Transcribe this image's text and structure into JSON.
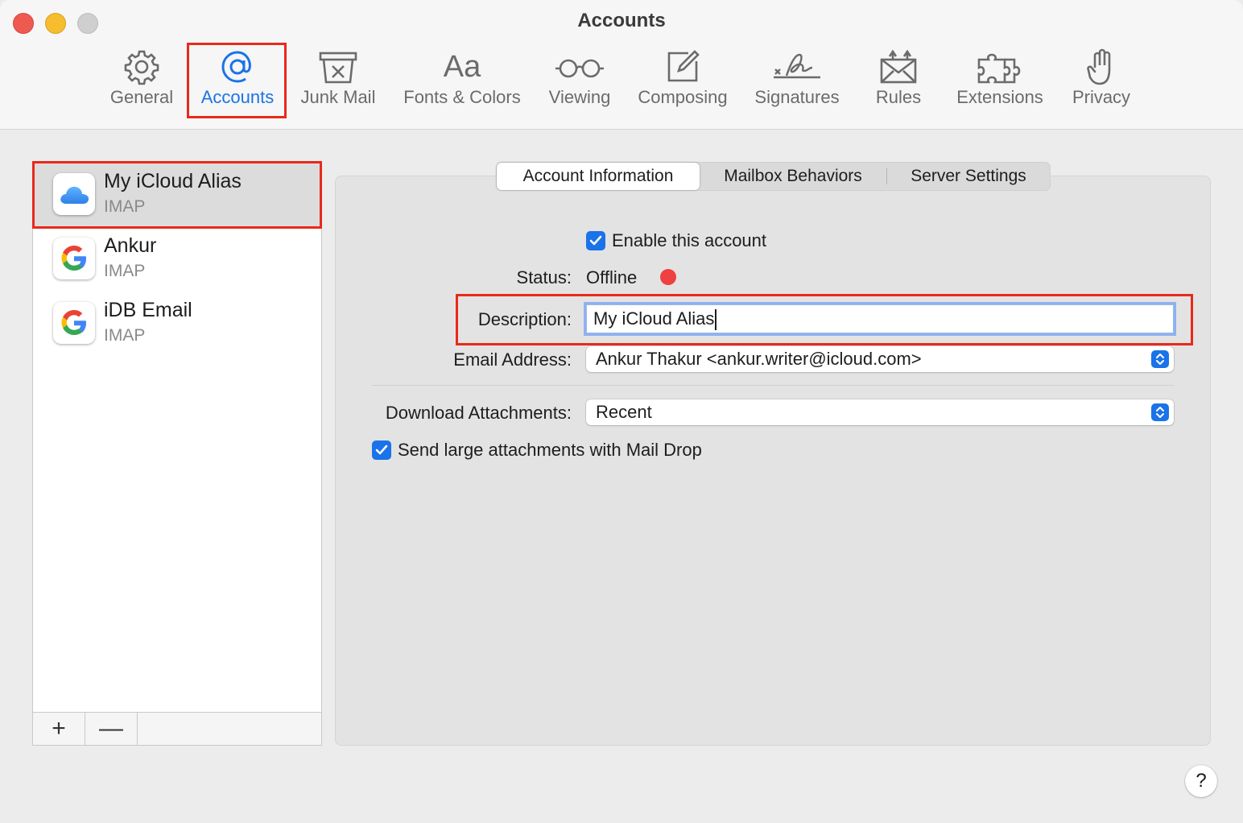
{
  "window": {
    "title": "Accounts"
  },
  "toolbar": {
    "items": [
      {
        "label": "General",
        "icon": "gear-icon"
      },
      {
        "label": "Accounts",
        "icon": "at-sign-icon"
      },
      {
        "label": "Junk Mail",
        "icon": "junk-mail-icon"
      },
      {
        "label": "Fonts & Colors",
        "icon": "fonts-icon",
        "glyph": "Aa"
      },
      {
        "label": "Viewing",
        "icon": "glasses-icon"
      },
      {
        "label": "Composing",
        "icon": "compose-icon"
      },
      {
        "label": "Signatures",
        "icon": "signature-icon"
      },
      {
        "label": "Rules",
        "icon": "rules-envelope-icon"
      },
      {
        "label": "Extensions",
        "icon": "puzzle-icon"
      },
      {
        "label": "Privacy",
        "icon": "hand-icon"
      }
    ],
    "active": "Accounts"
  },
  "sidebar": {
    "accounts": [
      {
        "name": "My iCloud Alias",
        "type": "IMAP",
        "icon": "icloud-icon",
        "selected": true
      },
      {
        "name": "Ankur",
        "type": "IMAP",
        "icon": "google-icon",
        "selected": false
      },
      {
        "name": "iDB Email",
        "type": "IMAP",
        "icon": "google-icon",
        "selected": false
      }
    ],
    "add_label": "+",
    "remove_label": "—"
  },
  "tabs": [
    {
      "label": "Account Information",
      "active": true
    },
    {
      "label": "Mailbox Behaviors",
      "active": false
    },
    {
      "label": "Server Settings",
      "active": false
    }
  ],
  "form": {
    "enable_label": "Enable this account",
    "enable_checked": true,
    "status_label": "Status:",
    "status_value": "Offline",
    "status_color": "#ef4141",
    "description_label": "Description:",
    "description_value": "My iCloud Alias",
    "email_label": "Email Address:",
    "email_value": "Ankur Thakur <ankur.writer@icloud.com>",
    "download_label": "Download Attachments:",
    "download_value": "Recent",
    "maildrop_label": "Send large attachments with Mail Drop",
    "maildrop_checked": true
  },
  "help_label": "?",
  "colors": {
    "accent": "#1a73e8",
    "highlight": "#e8291c"
  }
}
